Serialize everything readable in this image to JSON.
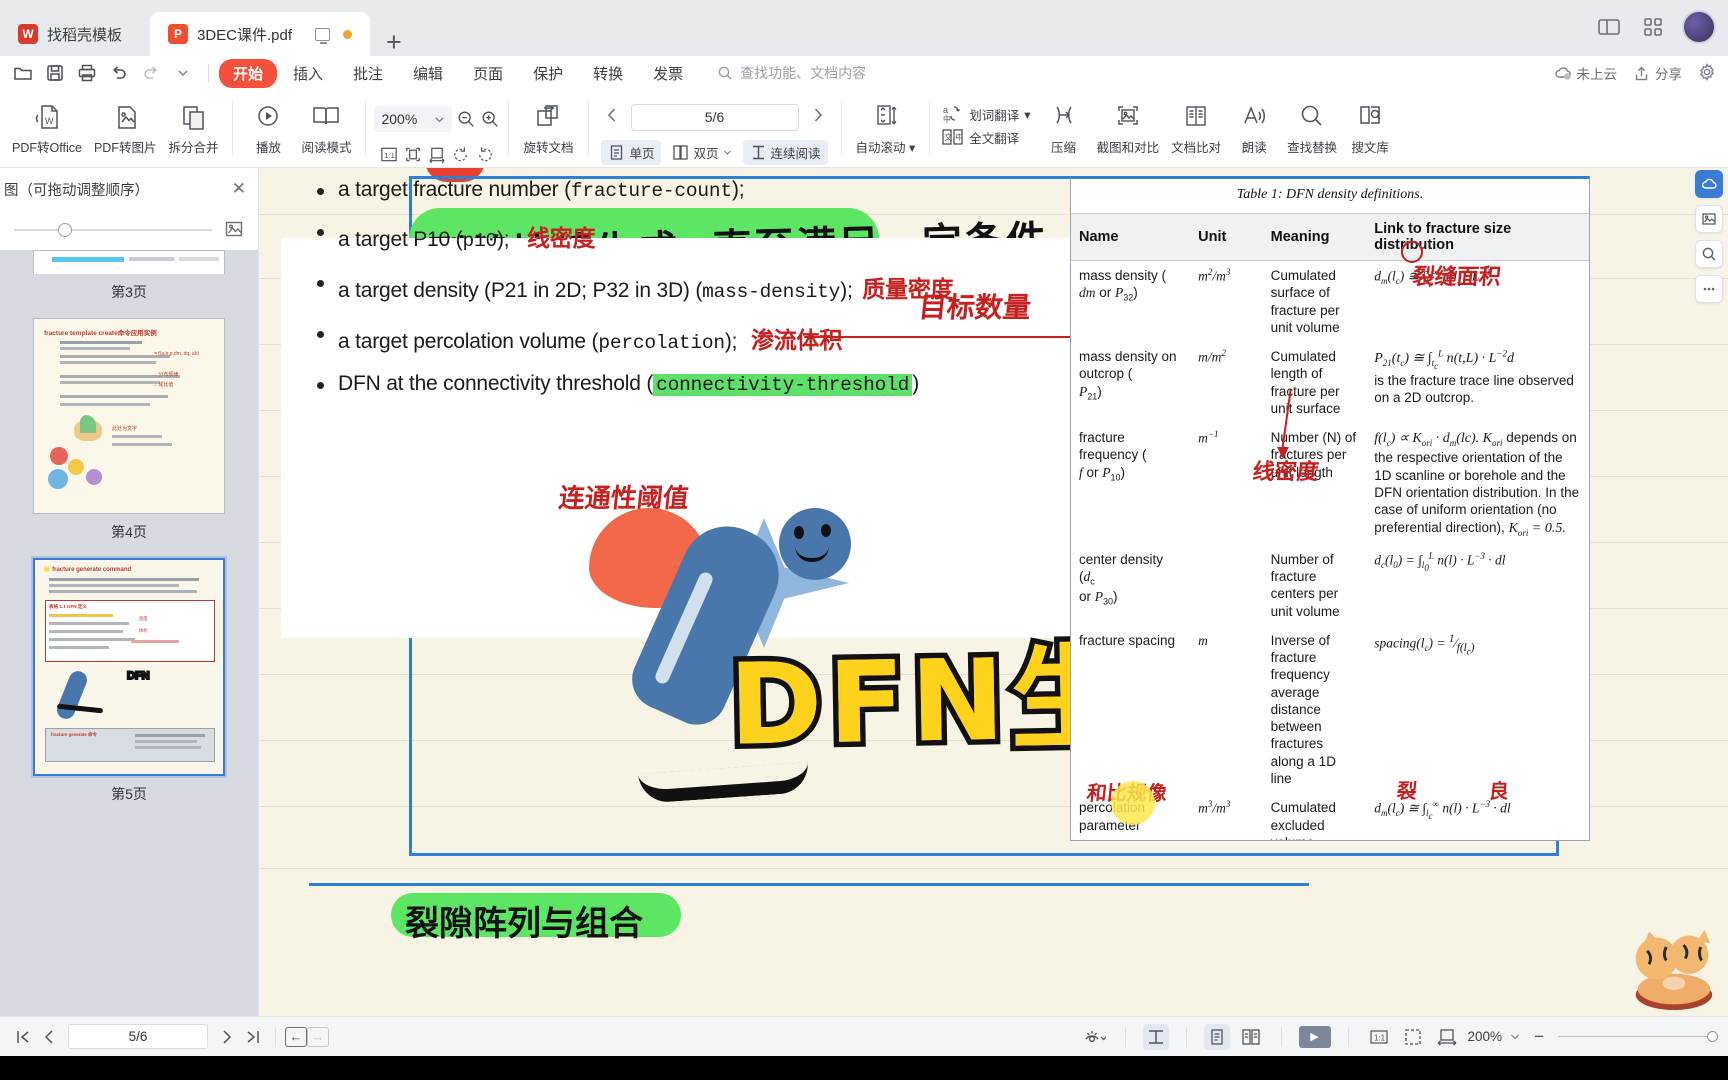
{
  "window": {
    "tabs": [
      {
        "label": "找稻壳模板",
        "icon": "wps-logo-icon",
        "active": false
      },
      {
        "label": "3DEC课件.pdf",
        "icon": "pdf-file-icon",
        "active": true
      }
    ],
    "new_tab": "+"
  },
  "menubar": {
    "quick_access": [
      "open-icon",
      "save-icon",
      "print-icon",
      "undo-icon",
      "redo-icon",
      "customize-chevron-icon"
    ],
    "items": [
      {
        "label": "开始",
        "active": true
      },
      {
        "label": "插入",
        "active": false
      },
      {
        "label": "批注",
        "active": false
      },
      {
        "label": "编辑",
        "active": false
      },
      {
        "label": "页面",
        "active": false
      },
      {
        "label": "保护",
        "active": false
      },
      {
        "label": "转换",
        "active": false
      },
      {
        "label": "发票",
        "active": false
      }
    ],
    "search_placeholder": "查找功能、文档内容",
    "cloud_status": "未上云",
    "share": "分享"
  },
  "ribbon": {
    "buttons": [
      {
        "label": "PDF转Office",
        "icon": "pdf-to-office-icon",
        "dropdown": true
      },
      {
        "label": "PDF转图片",
        "icon": "pdf-to-image-icon",
        "dropdown": false
      },
      {
        "label": "拆分合并",
        "icon": "split-merge-icon",
        "dropdown": true
      },
      {
        "label": "播放",
        "icon": "play-circle-icon",
        "dropdown": false
      },
      {
        "label": "阅读模式",
        "icon": "book-open-icon",
        "dropdown": false
      }
    ],
    "zoom_value": "200%",
    "zoom_out_icon": "zoom-out-icon",
    "zoom_in_icon": "zoom-in-icon",
    "fit_icons": [
      "actual-size-icon",
      "fit-page-icon",
      "fit-width-icon",
      "rotate-ccw-icon",
      "rotate-cw-icon"
    ],
    "rotate_doc": "旋转文档",
    "page_value": "5/6",
    "prev_icon": "chevron-left-icon",
    "next_icon": "chevron-right-icon",
    "view_modes": [
      {
        "label": "单页",
        "icon": "single-page-icon",
        "on": true
      },
      {
        "label": "双页",
        "icon": "double-page-icon",
        "on": false,
        "dropdown": true
      },
      {
        "label": "连续阅读",
        "icon": "continuous-scroll-icon",
        "on": true
      }
    ],
    "auto_scroll": "自动滚动",
    "translate_word": "划词翻译",
    "translate_full": "全文翻译",
    "compress": "压缩",
    "screenshot_compare": "截图和对比",
    "doc_compare": "文档比对",
    "read_aloud": "朗读",
    "find_replace": "查找替换",
    "search_library": "搜文库"
  },
  "sidebar": {
    "title": "图（可拖动调整顺序）",
    "close_icon": "close-icon",
    "image_icon": "image-icon",
    "thumbnails": [
      {
        "label": "第3页",
        "selected": false
      },
      {
        "label": "第4页",
        "selected": false
      },
      {
        "label": "第5页",
        "selected": true
      }
    ]
  },
  "document": {
    "heading_handwriting": "裂缝持续生成, 直至满足一定条件",
    "bullets": [
      {
        "text": "a target fracture number (",
        "code": "fracture-count",
        "tail": ");",
        "annot": "目标数量"
      },
      {
        "text": "a target P10 (",
        "code": "p10",
        "tail": ");",
        "annot": "线密度"
      },
      {
        "text": "a target density (P21 in 2D; P32 in 3D) (",
        "code": "mass-density",
        "tail": ");",
        "annot": "质量密度"
      },
      {
        "text": "a target percolation volume (",
        "code": "percolation",
        "tail": ");",
        "annot": "渗流体积"
      },
      {
        "text": "DFN at the connectivity threshold (",
        "code": "connectivity-threshold",
        "tail": ")",
        "annot": "连通性阈值"
      }
    ],
    "graffiti_text": "DFN生成命令",
    "annotation_red_1": "裂缝面积",
    "annotation_red_2": "线密度",
    "annotation_red_3": "和比规像",
    "annotation_red_4": "裂",
    "annotation_red_5": "良"
  },
  "table": {
    "caption": "Table 1: DFN density definitions.",
    "headers": [
      "Name",
      "Unit",
      "Meaning",
      "Link to fracture size distribution"
    ],
    "rows": [
      {
        "name": "mass density ( dm or P32 )",
        "unit": "m2/m3",
        "meaning": "Cumulated surface of fracture per unit volume",
        "link": "dm(lc) ≅ ∫lc∞ n(l) · L−3"
      },
      {
        "name": "mass density on outcrop ( P21 )",
        "unit": "m/m2",
        "meaning": "Cumulated length of fracture per unit surface",
        "link": "P21(tc) ≅ ∫tcL n(t,L) · L−2 dl is the fracture trace line observed on a 2D outcrop."
      },
      {
        "name": "fracture frequency ( f or P10 )",
        "unit": "m−1",
        "meaning": "Number (N) of fractures per unit length",
        "link": "f(lc) ∝ Kori · dm(lc). Kori depends on the respective orientation of the 1D scanline or borehole and the DFN orientation distribution. In the case of uniform orientation (no preferential direction), Kori = 0.5."
      },
      {
        "name": "center density ( dc or P30 )",
        "unit": "",
        "meaning": "Number of fracture centers per unit volume",
        "link": "dc(l0) = ∫l0L n(l) · L−3 · dl"
      },
      {
        "name": "fracture spacing",
        "unit": "m",
        "meaning": "Inverse of fracture frequency average distance between fractures along a 1D line",
        "link": "spacing(lc) = 1/f(lc)"
      },
      {
        "name": "percolation parameter",
        "unit": "m3/m3",
        "meaning": "Cumulated excluded volume around fractures per unit volume",
        "link": "dm(lc) ≅ ∫lc∞ n(l) · L−3 · dl"
      }
    ]
  },
  "rail": {
    "buttons": [
      "cloud-sync-icon",
      "image-tool-icon",
      "zoom-tool-icon",
      "more-options-icon"
    ]
  },
  "statusbar": {
    "first_icon": "first-page-icon",
    "prev_icon": "prev-page-icon",
    "page_value": "5/6",
    "next_icon": "next-page-icon",
    "last_icon": "last-page-icon",
    "back_icon": "nav-back-icon",
    "forward_icon": "nav-forward-icon",
    "eye_icon": "view-mode-icon",
    "layout_icons": [
      "continuous-layout-icon",
      "single-page-layout-icon",
      "double-page-layout-icon"
    ],
    "play_icon": "presentation-play-icon",
    "fit_icons": [
      "actual-size-icon",
      "fit-page-icon",
      "fit-width-icon"
    ],
    "zoom_value": "200%",
    "minus": "−"
  },
  "colors": {
    "accent_red": "#f4503b",
    "blue": "#2f7fd4",
    "green_highlight": "#5ce664",
    "graffiti_yellow": "#ffd21e",
    "paper": "#f7f4e6"
  }
}
